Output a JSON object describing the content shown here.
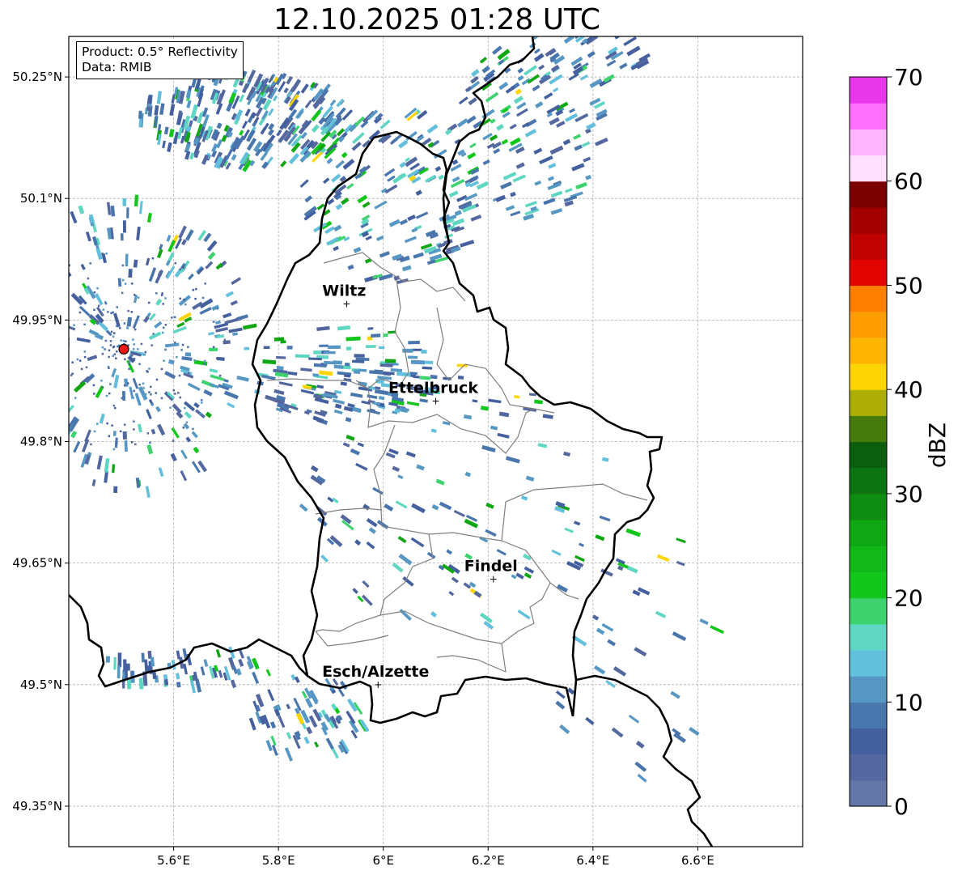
{
  "title": "12.10.2025 01:28 UTC",
  "info": {
    "product": "Product: 0.5° Reflectivity",
    "data": "Data: RMIB"
  },
  "axes": {
    "lon_range": [
      5.4,
      6.8
    ],
    "lat_range": [
      49.3,
      50.3
    ],
    "lon_ticks": [
      "5.6°E",
      "5.8°E",
      "6°E",
      "6.2°E",
      "6.4°E",
      "6.6°E"
    ],
    "lat_ticks": [
      "50.25°N",
      "50.1°N",
      "49.95°N",
      "49.8°N",
      "49.65°N",
      "49.5°N",
      "49.35°N"
    ],
    "grid": true
  },
  "cities": [
    {
      "name": "Wiltz",
      "lon": 5.93,
      "lat": 49.97
    },
    {
      "name": "Ettelbruck",
      "lon": 6.1,
      "lat": 49.85
    },
    {
      "name": "Findel",
      "lon": 6.21,
      "lat": 49.63
    },
    {
      "name": "Esch/Alzette",
      "lon": 5.99,
      "lat": 49.5
    }
  ],
  "radar_site": {
    "lon": 5.505,
    "lat": 49.914
  },
  "colorbar": {
    "label": "dBZ",
    "min": 0,
    "max": 70,
    "ticks": [
      "0",
      "10",
      "20",
      "30",
      "40",
      "50",
      "60",
      "70"
    ],
    "colors": [
      "#6476a8",
      "#54689f",
      "#45609f",
      "#4a76ae",
      "#5797c3",
      "#63c0dc",
      "#5fd6c2",
      "#3ed36f",
      "#12c61b",
      "#12b718",
      "#10a614",
      "#0f8d12",
      "#0c7410",
      "#0b5e0d",
      "#457a0c",
      "#adaf07",
      "#fed504",
      "#fdb502",
      "#fd9d00",
      "#fc7f00",
      "#e30301",
      "#c10100",
      "#a30000",
      "#7d0000",
      "#ffe0ff",
      "#ffb6ff",
      "#ff70ff",
      "#e836ea"
    ]
  },
  "colors": {
    "border": "#000000",
    "canton_border": "#7f7f7f",
    "grid": "#b0b0b0",
    "radar_site": "#e81818"
  }
}
